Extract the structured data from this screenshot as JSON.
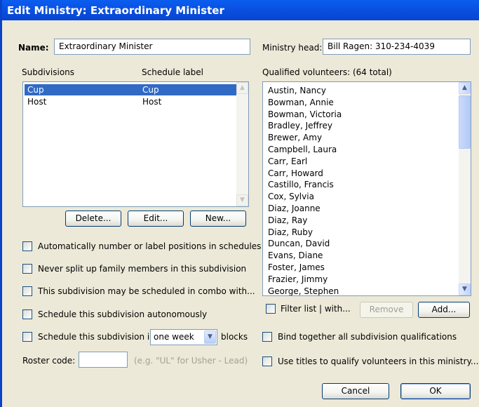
{
  "window": {
    "title": "Edit Ministry: Extraordinary Minister"
  },
  "name_field": {
    "label": "Name:",
    "value": "Extraordinary Minister"
  },
  "ministry_head": {
    "label": "Ministry head:",
    "value": "Bill Ragen: 310-234-4039"
  },
  "subdivisions": {
    "header_name": "Subdivisions",
    "header_schedule": "Schedule label",
    "rows": [
      {
        "name": "Cup",
        "label": "Cup",
        "selected": true
      },
      {
        "name": "Host",
        "label": "Host",
        "selected": false
      }
    ],
    "buttons": {
      "delete": "Delete...",
      "edit": "Edit...",
      "new": "New..."
    }
  },
  "options": {
    "auto_number": "Automatically number or label positions in schedules",
    "never_split": "Never split up family members in this subdivision",
    "combo": "This subdivision may be scheduled in combo with...",
    "autonomous": "Schedule this subdivision autonomously",
    "blocks_prefix": "Schedule this subdivision in",
    "blocks_value": "one week",
    "blocks_suffix": "blocks"
  },
  "roster": {
    "label": "Roster code:",
    "value": "",
    "hint": "(e.g. \"UL\" for Usher - Lead)"
  },
  "volunteers": {
    "header": "Qualified volunteers:  (64 total)",
    "items": [
      "Austin, Nancy",
      "Bowman, Annie",
      "Bowman, Victoria",
      "Bradley, Jeffrey",
      "Brewer, Amy",
      "Campbell, Laura",
      "Carr, Earl",
      "Carr, Howard",
      "Castillo, Francis",
      "Cox, Sylvia",
      "Diaz, Joanne",
      "Diaz, Ray",
      "Diaz, Ruby",
      "Duncan, David",
      "Evans, Diane",
      "Foster, James",
      "Frazier, Jimmy",
      "George, Stephen"
    ],
    "filter_label": "Filter list | with...",
    "remove": "Remove",
    "add": "Add..."
  },
  "right_options": {
    "bind": "Bind together all subdivision qualifications",
    "titles": "Use titles to qualify volunteers in this ministry..."
  },
  "footer": {
    "cancel": "Cancel",
    "ok": "OK"
  }
}
